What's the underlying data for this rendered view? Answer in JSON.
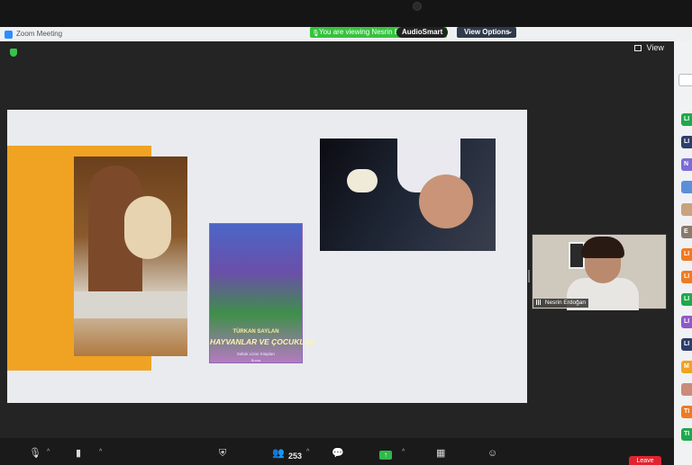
{
  "window": {
    "title": "Zoom Meeting"
  },
  "banner": {
    "viewing_text": "You are viewing Nesrin Erdoğan's screen",
    "audiosmart_label": "AudioSmart",
    "view_options_label": "View Options",
    "accent_green": "#35c33c"
  },
  "meeting": {
    "view_label": "View"
  },
  "slide": {
    "book": {
      "author": "TÜRKAN SAYLAN",
      "title": "HAYVANLAR VE ÇOCUKLAR",
      "publisher": "Saltuk Lizan Kitapları",
      "city": "Bursa"
    }
  },
  "video_tile": {
    "name": "Nesrin Erdoğan"
  },
  "sidebar": {
    "avatars": [
      {
        "label": "LI",
        "color": "#1ea94c"
      },
      {
        "label": "LI",
        "color": "#2c3e6b"
      },
      {
        "label": "N",
        "color": "#7c6cd6"
      },
      {
        "label": "",
        "color": "#5b8fd8"
      },
      {
        "label": "",
        "color": "#c9a27e"
      },
      {
        "label": "E",
        "color": "#8a7a6a"
      },
      {
        "label": "LI",
        "color": "#f07a22"
      },
      {
        "label": "LI",
        "color": "#f07a22"
      },
      {
        "label": "LI",
        "color": "#1ea94c"
      },
      {
        "label": "LI",
        "color": "#8f59c9"
      },
      {
        "label": "LI",
        "color": "#2c3e6b"
      },
      {
        "label": "M",
        "color": "#f0a323"
      },
      {
        "label": "",
        "color": "#c98b7a"
      },
      {
        "label": "TI",
        "color": "#f07a22"
      },
      {
        "label": "TI",
        "color": "#1ea94c"
      }
    ]
  },
  "toolbar": {
    "participants_count": "253",
    "leave_label": "Leave",
    "leave_color": "#e0242f"
  }
}
